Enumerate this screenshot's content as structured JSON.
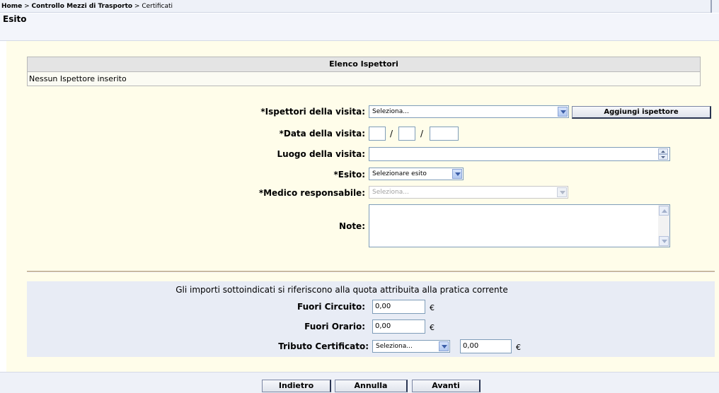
{
  "breadcrumb": {
    "home": "Home",
    "sep1": " > ",
    "section": "Controllo Mezzi di Trasporto",
    "sep2": " > ",
    "current": "Certificati"
  },
  "page_title": "Esito",
  "inspectors_table": {
    "header": "Elenco Ispettori",
    "empty_text": "Nessun Ispettore inserito"
  },
  "form": {
    "inspectors_label": "*Ispettori della visita:",
    "inspectors_select": "Seleziona...",
    "add_inspector_button": "Aggiungi ispettore",
    "date_label": "*Data della visita:",
    "date_day": "",
    "date_month": "",
    "date_year": "",
    "date_sep": "/",
    "place_label": "Luogo della visita:",
    "place_value": "",
    "outcome_label": "*Esito:",
    "outcome_select": "Selezionare esito",
    "doctor_label": "*Medico responsabile:",
    "doctor_select": "Seleziona...",
    "notes_label": "Note:",
    "notes_value": ""
  },
  "fees": {
    "note": "Gli importi sottoindicati si riferiscono alla quota attribuita alla pratica corrente",
    "out_of_circuit_label": "Fuori Circuito:",
    "out_of_circuit_value": "0,00",
    "out_of_hours_label": "Fuori Orario:",
    "out_of_hours_value": "0,00",
    "certificate_tax_label": "Tributo Certificato:",
    "certificate_tax_select": "Seleziona...",
    "certificate_tax_value": "0,00",
    "currency": "€"
  },
  "buttons": {
    "back": "Indietro",
    "cancel": "Annulla",
    "next": "Avanti"
  },
  "colors": {
    "form_background": "#fffdea",
    "fees_background": "#e8ecf5",
    "header_bar": "#eef1f8"
  }
}
